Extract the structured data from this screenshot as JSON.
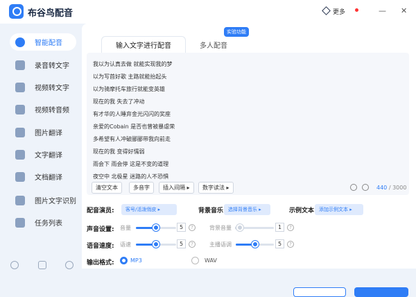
{
  "app": {
    "title": "布谷鸟配音",
    "more_label": "更多"
  },
  "window": {
    "minimize": "—",
    "close": "✕"
  },
  "sidebar": {
    "items": [
      {
        "label": "智能配音",
        "icon": "sound-icon"
      },
      {
        "label": "录音转文字",
        "icon": "record-icon"
      },
      {
        "label": "视频转文字",
        "icon": "video-text-icon"
      },
      {
        "label": "视频转音频",
        "icon": "video-audio-icon"
      },
      {
        "label": "图片翻译",
        "icon": "image-translate-icon"
      },
      {
        "label": "文字翻译",
        "icon": "text-translate-icon"
      },
      {
        "label": "文档翻译",
        "icon": "document-translate-icon"
      },
      {
        "label": "图片文字识别",
        "icon": "ocr-icon"
      },
      {
        "label": "任务列表",
        "icon": "task-list-icon"
      }
    ]
  },
  "tabs": {
    "active": "输入文字进行配音",
    "inactive": "多人配音",
    "badge": "实验功能"
  },
  "editor": {
    "lines": [
      "我以为认真去做 就能实现我的梦",
      "以为写首好歌 主路就能抬起头",
      "以为骑摩托车旅行就能变英雄",
      "现在的我 失去了冲动",
      "有才华的人睡弃金光闪闪的奖座",
      "亲爱的Cobain 是否也曾被暴虐荣",
      "多希望有人冲破郦郦带我向前走",
      "现在的我 变得好懦弱",
      "雨会下 雨会停 这是不变的道理",
      "夜空中 北极星 迷路的人不恐惧"
    ],
    "toolbar": {
      "clear": "清空文本",
      "polyphone": "多音字",
      "insert_pause": "插入间隔 ▸",
      "number_read": "数字读法 ▸"
    },
    "count": "440",
    "max": "/ 3000"
  },
  "settings": {
    "voice_label": "配音演员:",
    "voice_value": "客号/活泼俏皮 ▸",
    "bgm_label": "背景音乐",
    "bgm_value": "选择背景音乐 ▸",
    "sample_label": "示例文本",
    "sample_value": "添加示例文本 ▸",
    "sound_label": "声音设置:",
    "volume_label": "音量",
    "volume_value": "5",
    "volume_level": 0.5,
    "bg_volume_label": "背景音量",
    "bg_volume_value": "1",
    "bg_volume_level": 0.1,
    "speed_label": "语音速度:",
    "speed_sub": "语速",
    "speed_value": "5",
    "speed_level": 0.5,
    "main_speed_label": "主播语调",
    "main_speed_value": "5",
    "main_speed_level": 0.5,
    "format_label": "输出格式:",
    "format_mp3": "MP3",
    "format_wav": "WAV",
    "help_glyph": "?"
  },
  "colors": {
    "accent": "#2f7df6"
  }
}
